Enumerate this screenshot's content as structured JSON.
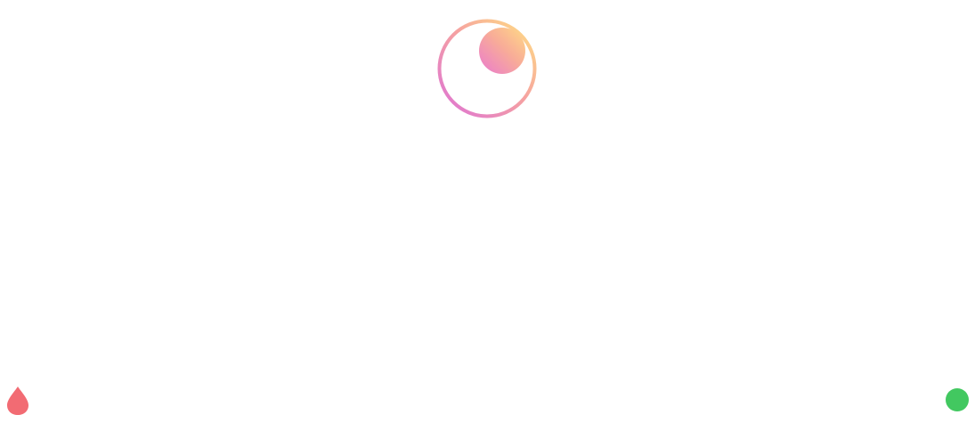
{
  "logo": {
    "icon": "gradient-ring-with-orb",
    "gradient_start": "#e37ccc",
    "gradient_end": "#ffd98a",
    "orb_start": "#ef86c4",
    "orb_end": "#ffd585"
  },
  "indicators": {
    "drop": {
      "icon": "droplet-icon",
      "color": "#f26b73"
    },
    "status": {
      "icon": "status-dot-icon",
      "color": "#42c860"
    }
  }
}
